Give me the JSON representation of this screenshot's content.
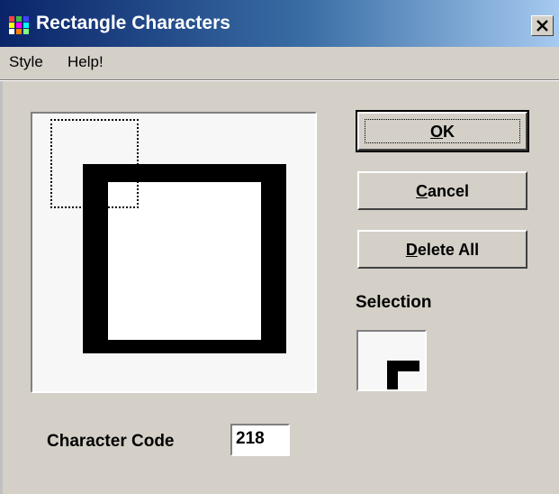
{
  "window": {
    "title": "Rectangle Characters",
    "close_label": "×",
    "icon": "app-grid-icon"
  },
  "menu": {
    "items": [
      {
        "label": "Style"
      },
      {
        "label": "Help!"
      }
    ]
  },
  "buttons": {
    "ok": {
      "mnemonic": "O",
      "rest": "K"
    },
    "cancel": {
      "mnemonic": "C",
      "rest": "ancel"
    },
    "delete_all": {
      "mnemonic": "D",
      "rest": "elete All"
    }
  },
  "selection": {
    "label": "Selection"
  },
  "character_code": {
    "label": "Character Code",
    "value": "218"
  },
  "colors": {
    "titlebar_start": "#0a246a",
    "titlebar_end": "#a6caf0",
    "face": "#d4d0c8"
  }
}
